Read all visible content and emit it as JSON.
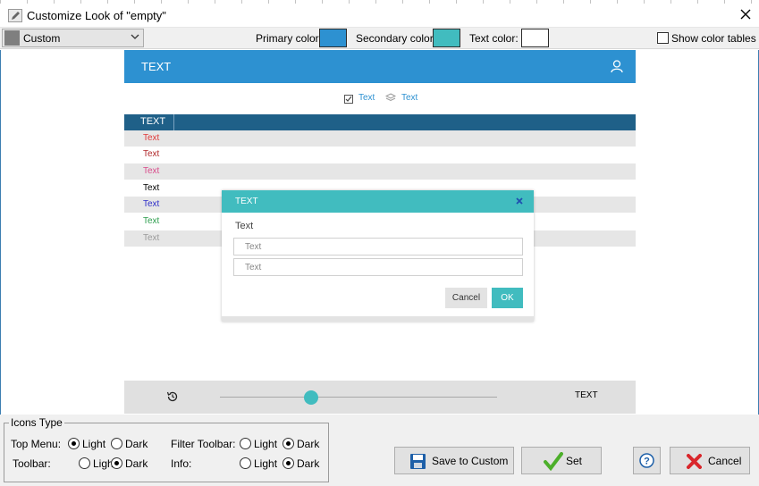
{
  "window": {
    "title": "Customize Look of \"empty\""
  },
  "colorbar": {
    "preset": "Custom",
    "primary_label": "Primary color:",
    "primary_color": "#2d91d1",
    "secondary_label": "Secondary color:",
    "secondary_color": "#41bcbf",
    "text_label": "Text color:",
    "text_color": "#ffffff",
    "show_tables_label": "Show color tables",
    "show_tables_checked": false
  },
  "preview": {
    "header_title": "TEXT",
    "tab_checkbox_label": "Text",
    "tab_layers_label": "Text",
    "table_header": "TEXT",
    "rows": [
      {
        "text": "Text",
        "color": "#e0393a"
      },
      {
        "text": "Text",
        "color": "#b0282a"
      },
      {
        "text": "Text",
        "color": "#d94c8b"
      },
      {
        "text": "Text",
        "color": "#000000"
      },
      {
        "text": "Text",
        "color": "#2e2ec8"
      },
      {
        "text": "Text",
        "color": "#2e9e4e"
      },
      {
        "text": "Text",
        "color": "#9a9a9a"
      }
    ],
    "dialog": {
      "title": "TEXT",
      "label": "Text",
      "field1_placeholder": "Text",
      "field2_placeholder": "Text",
      "cancel": "Cancel",
      "ok": "OK"
    },
    "bottom_text": "TEXT",
    "slider_value_fraction": 0.33
  },
  "icons_type": {
    "legend": "Icons Type",
    "top_menu_label": "Top Menu:",
    "toolbar_label": "Toolbar:",
    "filter_toolbar_label": "Filter Toolbar:",
    "info_label": "Info:",
    "light": "Light",
    "dark": "Dark",
    "top_menu_value": "Light",
    "toolbar_value": "Dark",
    "filter_toolbar_value": "Dark",
    "info_value": "Dark"
  },
  "buttons": {
    "save_to_custom": "Save to Custom",
    "set": "Set",
    "cancel": "Cancel"
  }
}
